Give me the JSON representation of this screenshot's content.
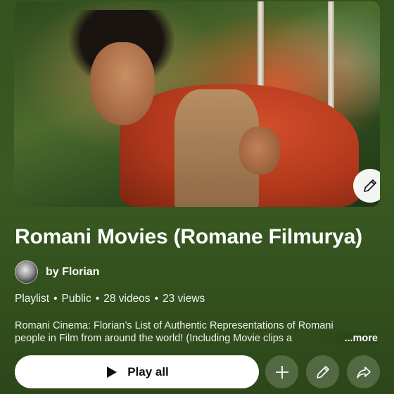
{
  "playlist": {
    "title": "Romani Movies (Romane Filmurya)",
    "owner": "by Florian",
    "meta": {
      "type": "Playlist",
      "visibility": "Public",
      "videos": "28 videos",
      "views": "23 views"
    },
    "description_line1": "Romani Cinema: Florian’s List of Authentic Representations of Romani",
    "description_line2": "people in Film from around the world! (Including Movie clips a",
    "more_label": "...more"
  },
  "actions": {
    "play_all": "Play all",
    "icons": [
      "play-icon",
      "plus-icon",
      "pencil-icon",
      "share-icon"
    ]
  },
  "colors": {
    "background": "#35531f",
    "button": "#ffffff",
    "accent_text": "#0f0f0f"
  }
}
